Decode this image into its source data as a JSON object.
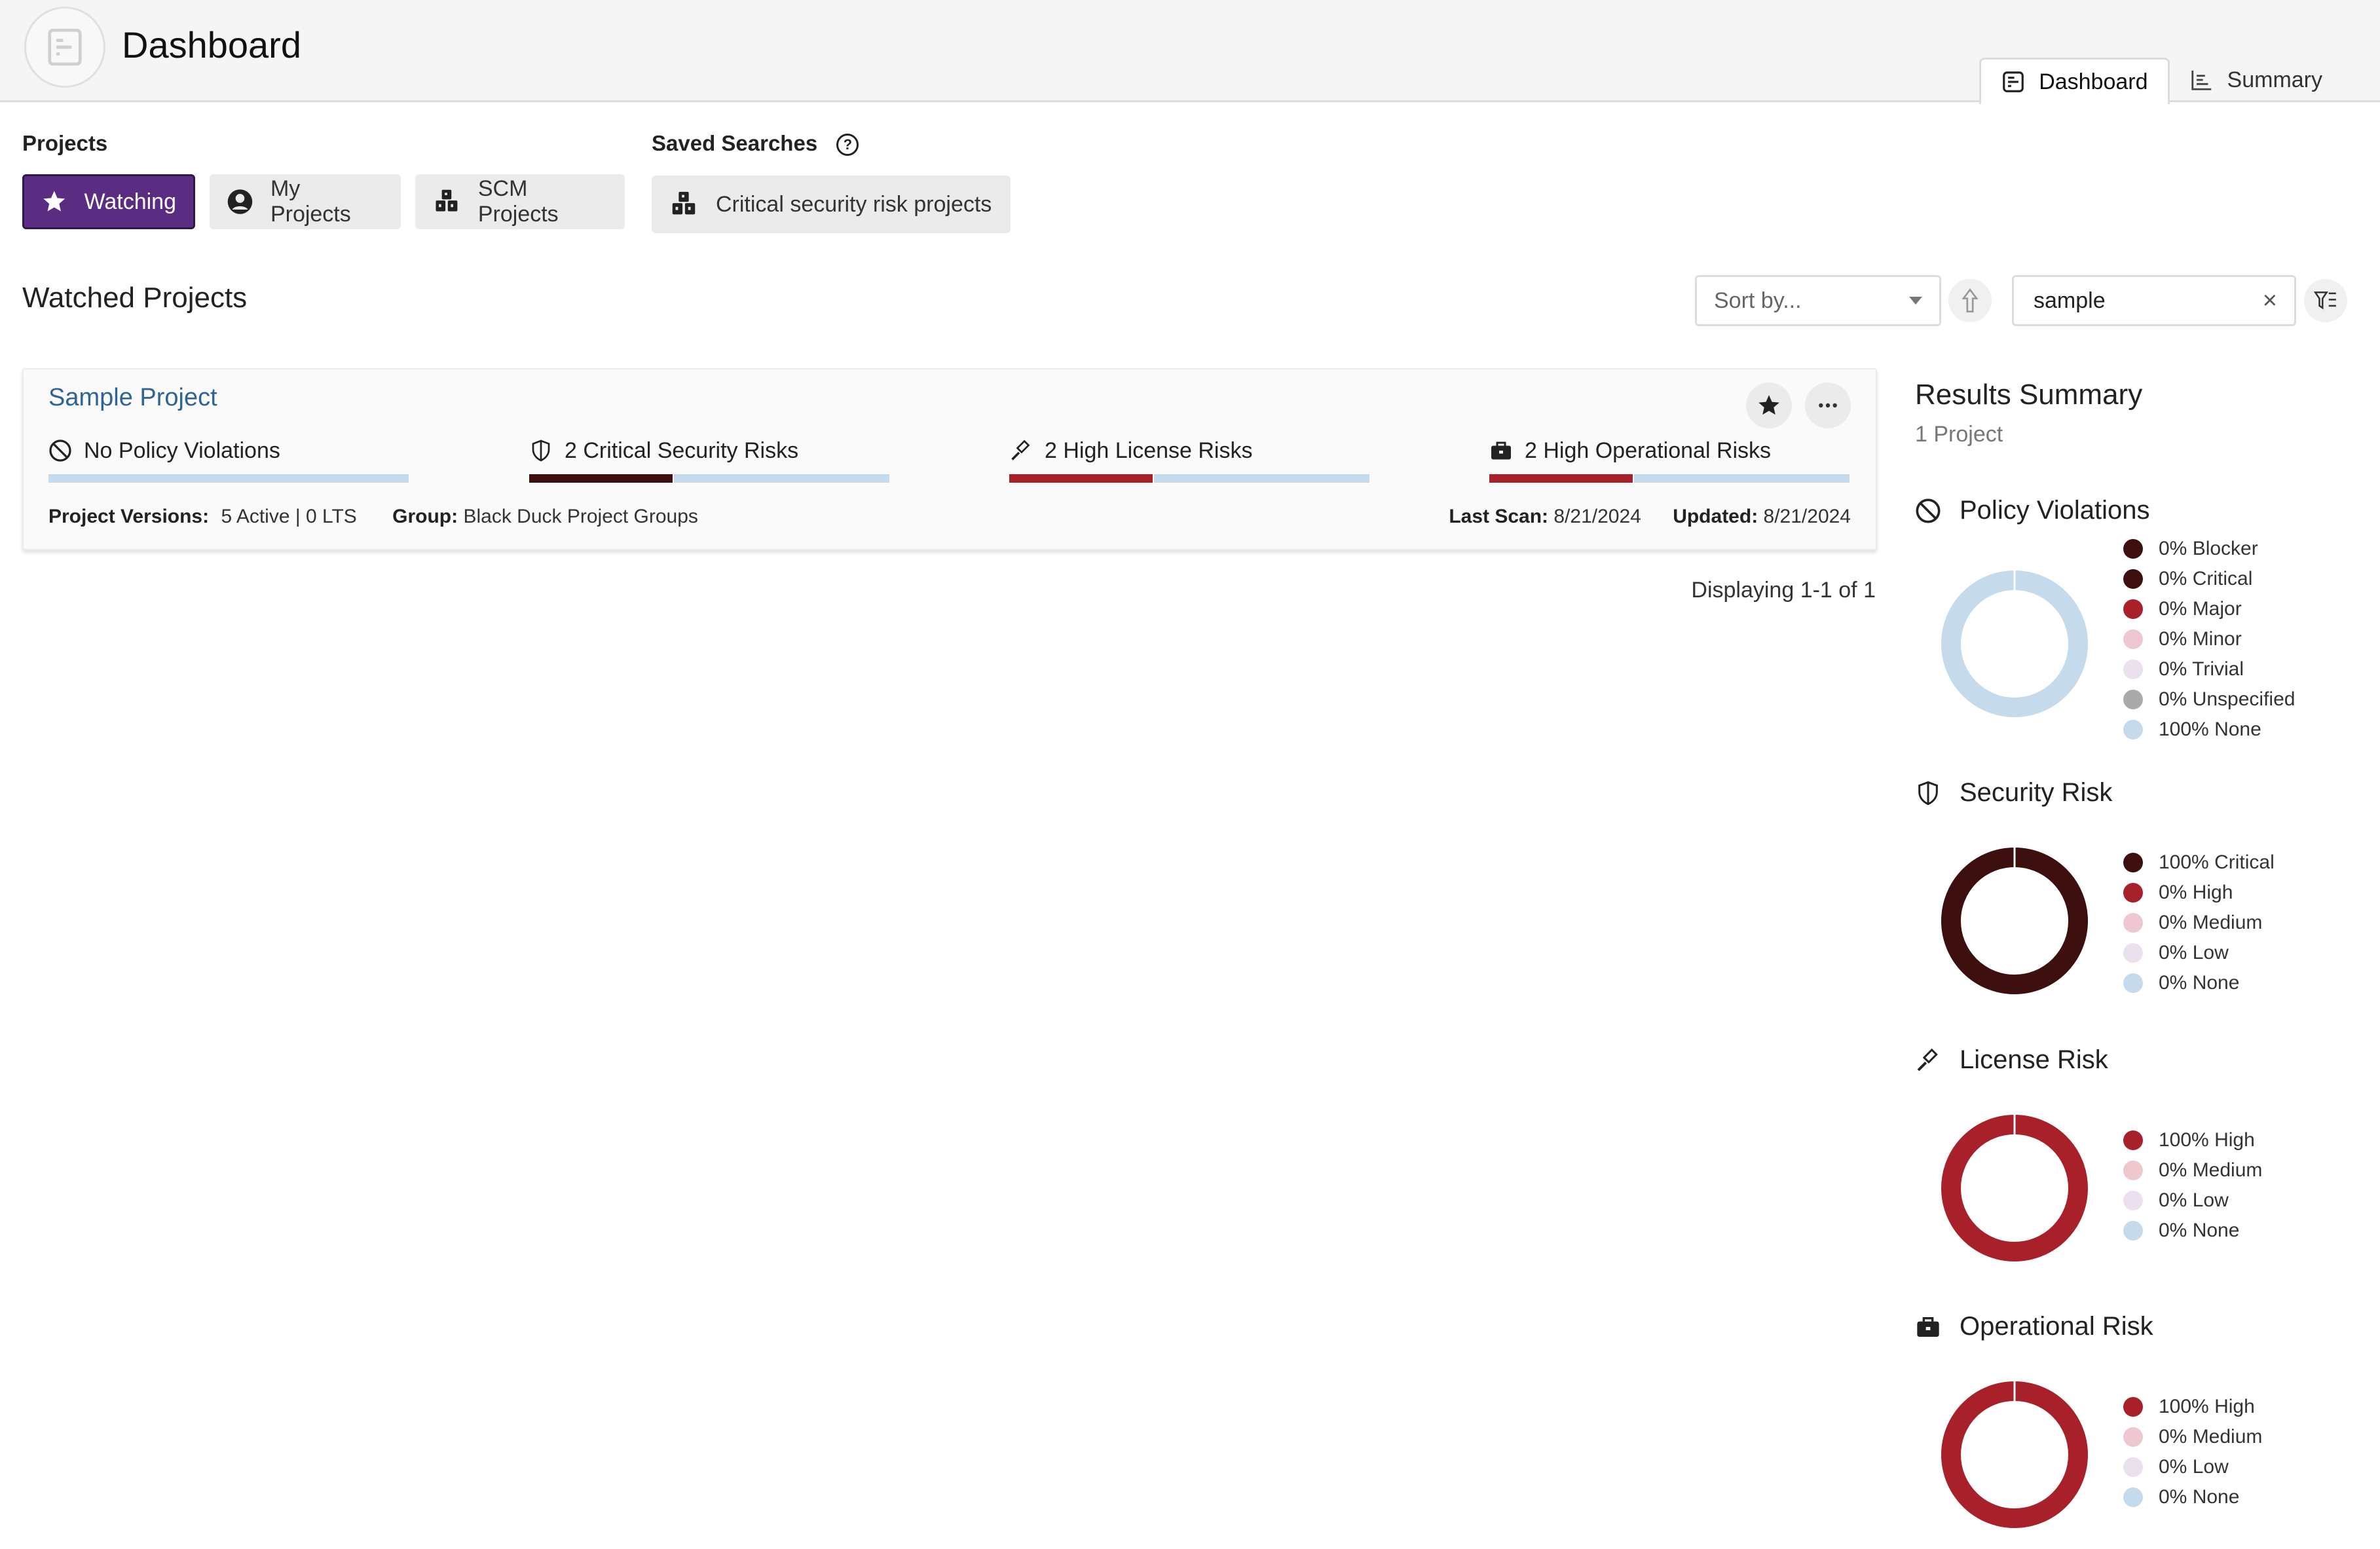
{
  "header": {
    "title": "Dashboard",
    "tabs": [
      {
        "label": "Dashboard",
        "icon": "dashboard-icon",
        "active": true
      },
      {
        "label": "Summary",
        "icon": "summary-chart-icon",
        "active": false
      }
    ]
  },
  "projects_filter": {
    "label": "Projects",
    "chips": [
      {
        "label": "Watching",
        "icon": "star-icon",
        "active": true
      },
      {
        "label": "My Projects",
        "icon": "user-circle-icon",
        "active": false
      },
      {
        "label": "SCM Projects",
        "icon": "cubes-icon",
        "active": false
      }
    ]
  },
  "saved_searches": {
    "label": "Saved Searches",
    "help_icon": "?",
    "items": [
      {
        "label": "Critical security risk projects",
        "icon": "cubes-icon"
      }
    ]
  },
  "watched": {
    "title": "Watched Projects",
    "sort_placeholder": "Sort by...",
    "search_value": "sample",
    "clear_symbol": "×",
    "displaying": "Displaying 1-1 of 1"
  },
  "projects": [
    {
      "name": "Sample Project",
      "risks": [
        {
          "label": "No Policy Violations",
          "icon": "ban-icon",
          "fill_fraction": 0,
          "fill_color": "#c5daeb"
        },
        {
          "label": "2 Critical Security Risks",
          "icon": "shield-icon",
          "fill_fraction": 0.4,
          "fill_color": "#3e0f0f"
        },
        {
          "label": "2 High License Risks",
          "icon": "gavel-icon",
          "fill_fraction": 0.4,
          "fill_color": "#a8212a"
        },
        {
          "label": "2 High Operational Risks",
          "icon": "briefcase-icon",
          "fill_fraction": 0.4,
          "fill_color": "#a8212a"
        }
      ],
      "versions_label": "Project Versions:",
      "versions_value": "5 Active | 0 LTS",
      "group_label": "Group:",
      "group_value": "Black Duck Project Groups",
      "last_scan_label": "Last Scan:",
      "last_scan_value": "8/21/2024",
      "updated_label": "Updated:",
      "updated_value": "8/21/2024"
    }
  ],
  "summary": {
    "title": "Results Summary",
    "subtitle": "1 Project"
  },
  "colors": {
    "accent": "#5a2d82",
    "link": "#2f6496",
    "blocker": "#3e0f0f",
    "critical": "#3e0f0f",
    "high": "#a8212a",
    "medium": "#efc8cf",
    "low": "#ebe0ee",
    "unspecified": "#aaaaaa",
    "none": "#c5daeb"
  },
  "chart_data": [
    {
      "type": "pie",
      "title": "Policy Violations",
      "icon": "ban-icon",
      "categories": [
        "Blocker",
        "Critical",
        "Major",
        "Minor",
        "Trivial",
        "Unspecified",
        "None"
      ],
      "values": [
        0,
        0,
        0,
        0,
        0,
        0,
        100
      ],
      "colors": [
        "#3e0f0f",
        "#3e0f0f",
        "#a8212a",
        "#efc8cf",
        "#ebe0ee",
        "#aaaaaa",
        "#c5daeb"
      ],
      "legend": [
        "0% Blocker",
        "0% Critical",
        "0% Major",
        "0% Minor",
        "0% Trivial",
        "0% Unspecified",
        "100% None"
      ],
      "legend_position": "right"
    },
    {
      "type": "pie",
      "title": "Security Risk",
      "icon": "shield-icon",
      "categories": [
        "Critical",
        "High",
        "Medium",
        "Low",
        "None"
      ],
      "values": [
        100,
        0,
        0,
        0,
        0
      ],
      "colors": [
        "#3e0f0f",
        "#a8212a",
        "#efc8cf",
        "#ebe0ee",
        "#c5daeb"
      ],
      "legend": [
        "100% Critical",
        "0% High",
        "0% Medium",
        "0% Low",
        "0% None"
      ],
      "legend_position": "right"
    },
    {
      "type": "pie",
      "title": "License Risk",
      "icon": "gavel-icon",
      "categories": [
        "High",
        "Medium",
        "Low",
        "None"
      ],
      "values": [
        100,
        0,
        0,
        0
      ],
      "colors": [
        "#a8212a",
        "#efc8cf",
        "#ebe0ee",
        "#c5daeb"
      ],
      "legend": [
        "100% High",
        "0% Medium",
        "0% Low",
        "0% None"
      ],
      "legend_position": "right"
    },
    {
      "type": "pie",
      "title": "Operational Risk",
      "icon": "briefcase-icon",
      "categories": [
        "High",
        "Medium",
        "Low",
        "None"
      ],
      "values": [
        100,
        0,
        0,
        0
      ],
      "colors": [
        "#a8212a",
        "#efc8cf",
        "#ebe0ee",
        "#c5daeb"
      ],
      "legend": [
        "100% High",
        "0% Medium",
        "0% Low",
        "0% None"
      ],
      "legend_position": "right"
    }
  ]
}
